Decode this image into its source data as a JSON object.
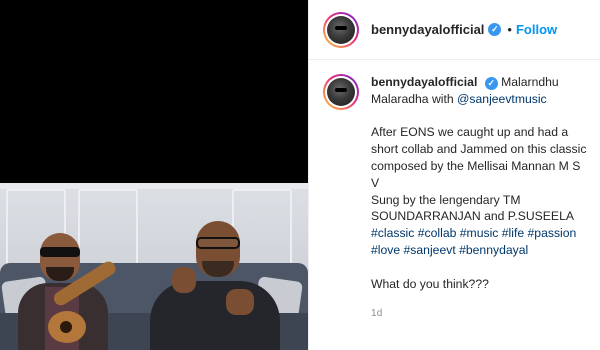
{
  "post": {
    "username": "bennydayalofficial",
    "verified_icon": "verified-badge-icon",
    "dot": "•",
    "follow_label": "Follow",
    "caption": {
      "username": "bennydayalofficial",
      "title_part1": "Malarndhu",
      "title_part2": "Malaradha with",
      "mention": "@sanjeevtmusic",
      "para1": "After EONS we caught up and had a short collab and Jammed on this classic composed by the Mellisai Mannan M S V",
      "para2": "Sung by the lengendary TM SOUNDARRANJAN and P.SUSEELA",
      "hashtags": [
        "#classic",
        "#collab",
        "#music",
        "#life",
        "#passion",
        "#love",
        "#sanjeevt",
        "#bennydayal"
      ],
      "question": "What do you think???",
      "timestamp": "1d"
    }
  },
  "colors": {
    "accent": "#0095f6",
    "verified": "#3897f0",
    "link": "#00376b",
    "muted": "#8e8e8e"
  }
}
